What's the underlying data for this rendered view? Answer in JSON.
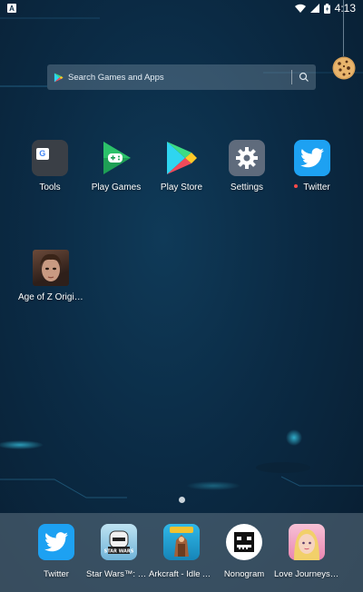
{
  "status_bar": {
    "notification_icon": "A",
    "icons": [
      "wifi-icon",
      "signal-icon",
      "battery-icon"
    ],
    "time": "4:13"
  },
  "search": {
    "placeholder": "Search Games and Apps",
    "icon": "play-store-icon",
    "button_icon": "search-icon"
  },
  "widget": {
    "icon": "cookie-icon"
  },
  "home_apps": [
    {
      "label": "Tools",
      "icon": "tools-folder-icon"
    },
    {
      "label": "Play Games",
      "icon": "play-games-icon"
    },
    {
      "label": "Play Store",
      "icon": "play-store-icon"
    },
    {
      "label": "Settings",
      "icon": "settings-gear-icon"
    },
    {
      "label": "Twitter",
      "icon": "twitter-icon",
      "badge": "new"
    },
    {
      "label": "Age of Z Origins",
      "icon": "age-of-z-icon"
    }
  ],
  "page_indicator": {
    "pages": 1,
    "current": 1
  },
  "dock": [
    {
      "label": "Twitter",
      "icon": "twitter-icon"
    },
    {
      "label": "Star Wars™: Ca...",
      "icon": "star-wars-icon"
    },
    {
      "label": "Arkcraft - Idle A...",
      "icon": "arkcraft-icon"
    },
    {
      "label": "Nonogram",
      "icon": "nonogram-icon"
    },
    {
      "label": "Love Journeys:...",
      "icon": "love-journeys-icon"
    }
  ],
  "colors": {
    "wallpaper": "#0b2b45",
    "accent_cyan": "#3fe0ff",
    "twitter_blue": "#1da1f2",
    "settings_gray": "#5f6b7c",
    "badge_red": "#ff4a4a"
  }
}
